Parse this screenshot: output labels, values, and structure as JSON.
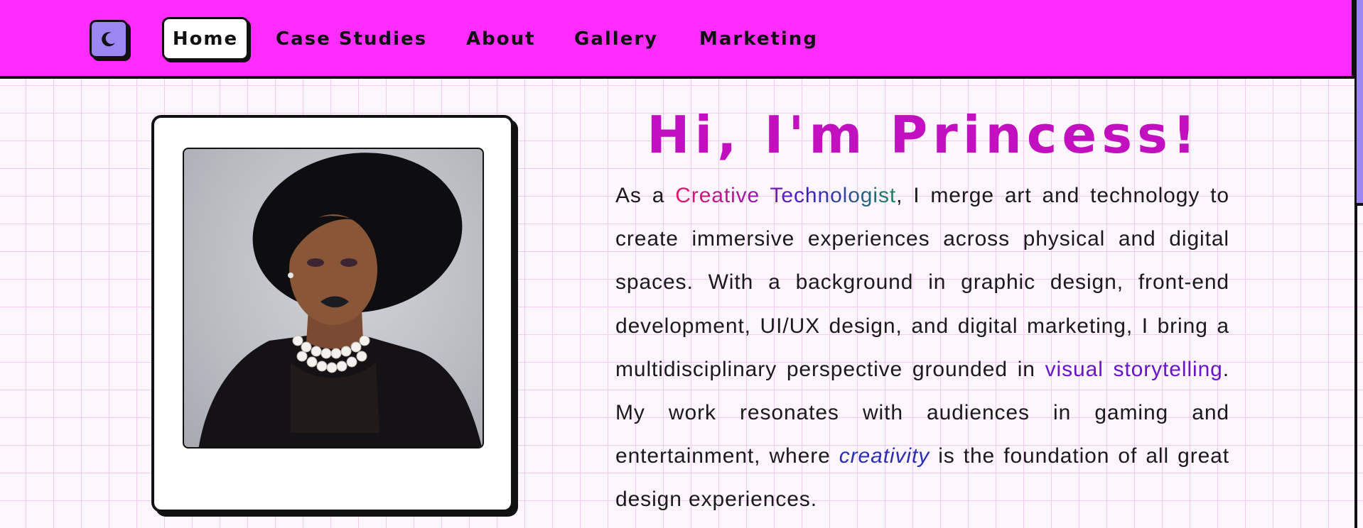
{
  "nav": {
    "logo_icon": "moon-icon",
    "items": [
      {
        "label": "Home",
        "active": true
      },
      {
        "label": "Case Studies",
        "active": false
      },
      {
        "label": "About",
        "active": false
      },
      {
        "label": "Gallery",
        "active": false
      },
      {
        "label": "Marketing",
        "active": false
      }
    ]
  },
  "hero": {
    "title": "Hi, I'm Princess!",
    "bio": {
      "p1": "As a ",
      "highlight1": "Creative Technologist",
      "p2": ", I merge art and technology to create immersive experiences across physical and digital spaces. With a background in graphic design, front-end development, UI/UX design, and digital marketing, I bring a multidisciplinary perspective grounded in ",
      "highlight2": "visual storytelling",
      "p3": ". My work resonates with audiences in gaming and entertainment, where ",
      "highlight3": "creativity",
      "p4": " is the foundation of all great design experiences."
    }
  },
  "colors": {
    "nav_bg": "#fe2cfe",
    "title": "#c20fbf",
    "accent_purple": "#9b86f3",
    "grid_line": "#f6c9f6"
  }
}
